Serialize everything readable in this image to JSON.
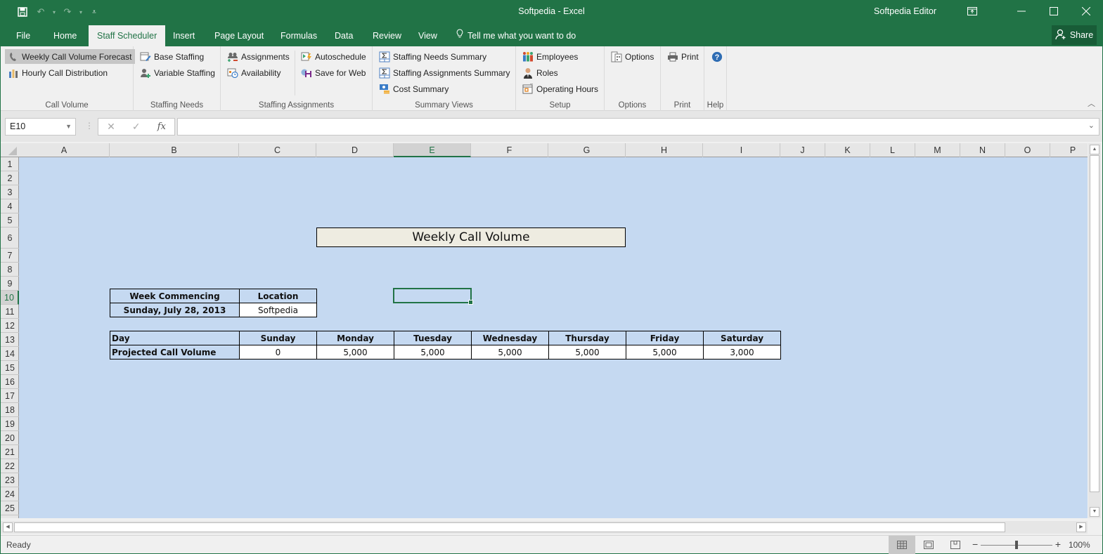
{
  "window": {
    "title": "Softpedia - Excel",
    "user": "Softpedia Editor"
  },
  "qat": {
    "save_icon": "save-icon",
    "undo_icon": "undo-icon",
    "redo_icon": "redo-icon",
    "customize_icon": "customize-qat-icon"
  },
  "tabs": [
    {
      "label": "File"
    },
    {
      "label": "Home"
    },
    {
      "label": "Staff Scheduler",
      "active": true
    },
    {
      "label": "Insert"
    },
    {
      "label": "Page Layout"
    },
    {
      "label": "Formulas"
    },
    {
      "label": "Data"
    },
    {
      "label": "Review"
    },
    {
      "label": "View"
    }
  ],
  "tellme": "Tell me what you want to do",
  "share": "Share",
  "ribbon": {
    "groups": [
      {
        "label": "Call Volume",
        "items": [
          {
            "label": "Weekly Call Volume Forecast",
            "icon": "phone-icon",
            "selected": true
          },
          {
            "label": "Hourly Call Distribution",
            "icon": "bar-chart-icon"
          }
        ]
      },
      {
        "label": "Staffing Needs",
        "items": [
          {
            "label": "Base Staffing",
            "icon": "calendar-edit-icon"
          },
          {
            "label": "Variable Staffing",
            "icon": "user-add-icon"
          }
        ]
      },
      {
        "label": "Staffing Assignments",
        "items": [
          {
            "label": "Assignments",
            "icon": "users-assign-icon"
          },
          {
            "label": "Availability",
            "icon": "calendar-clock-icon"
          },
          {
            "label": "Autoschedule",
            "icon": "autoschedule-icon"
          },
          {
            "label": "Save for Web",
            "icon": "save-web-icon"
          }
        ]
      },
      {
        "label": "Summary Views",
        "items": [
          {
            "label": "Staffing Needs Summary",
            "icon": "sigma-table-icon"
          },
          {
            "label": "Staffing Assignments Summary",
            "icon": "sigma-table-icon"
          },
          {
            "label": "Cost Summary",
            "icon": "cost-icon"
          }
        ]
      },
      {
        "label": "Setup",
        "items": [
          {
            "label": "Employees",
            "icon": "employees-icon"
          },
          {
            "label": "Roles",
            "icon": "role-person-icon"
          },
          {
            "label": "Operating Hours",
            "icon": "hours-table-icon"
          }
        ]
      },
      {
        "label": "Options",
        "items": [
          {
            "label": "Options",
            "icon": "options-icon"
          }
        ]
      },
      {
        "label": "Print",
        "items": [
          {
            "label": "Print",
            "icon": "printer-icon"
          }
        ]
      },
      {
        "label": "Help",
        "items": [
          {
            "label": "",
            "icon": "help-icon"
          }
        ]
      }
    ]
  },
  "formula_bar": {
    "name_box": "E10",
    "formula": "",
    "fx_label": "fx"
  },
  "sheet": {
    "columns": [
      "A",
      "B",
      "C",
      "D",
      "E",
      "F",
      "G",
      "H",
      "I",
      "J",
      "K",
      "L",
      "M",
      "N",
      "O",
      "P"
    ],
    "selected_column": "E",
    "rows": [
      "1",
      "2",
      "3",
      "4",
      "5",
      "6",
      "7",
      "8",
      "9",
      "10",
      "11",
      "12",
      "13",
      "14",
      "15",
      "16",
      "17",
      "18",
      "19",
      "20",
      "21",
      "22",
      "23",
      "24",
      "25"
    ],
    "selected_row": "10",
    "title": "Weekly Call Volume",
    "info_table": {
      "headers": [
        "Week Commencing",
        "Location"
      ],
      "values": [
        "Sunday, July 28, 2013",
        "Softpedia"
      ]
    },
    "volume_table": {
      "row_label_header": "Day",
      "row_label_values": "Projected Call Volume",
      "days": [
        "Sunday",
        "Monday",
        "Tuesday",
        "Wednesday",
        "Thursday",
        "Friday",
        "Saturday"
      ],
      "values": [
        "0",
        "5,000",
        "5,000",
        "5,000",
        "5,000",
        "5,000",
        "3,000"
      ]
    }
  },
  "status": {
    "text": "Ready",
    "zoom": "100%",
    "zoom_value_percent": 100
  }
}
